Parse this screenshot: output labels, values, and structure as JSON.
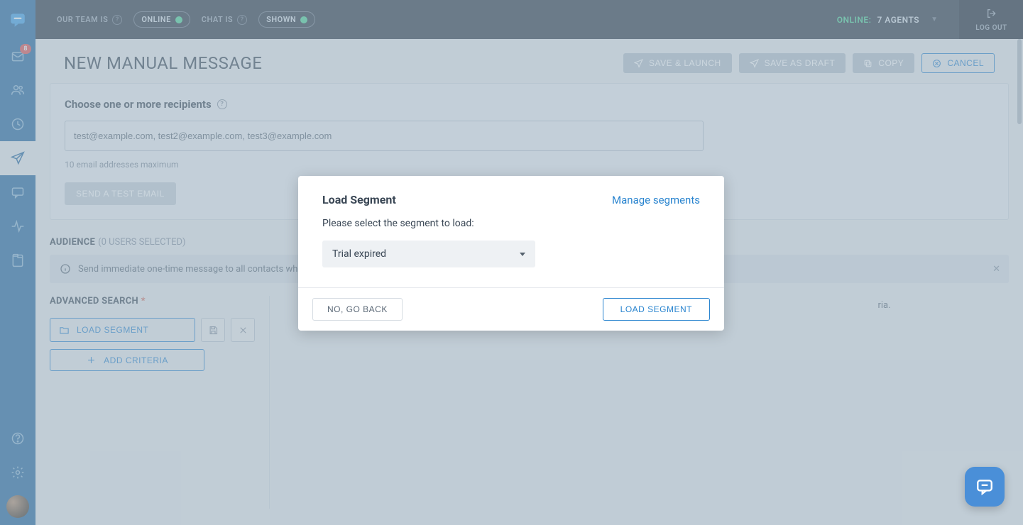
{
  "topbar": {
    "team_label": "OUR TEAM IS",
    "status_online": "ONLINE",
    "chat_label": "CHAT IS",
    "status_shown": "SHOWN",
    "online_label": "ONLINE:",
    "agents_count": "7 AGENTS",
    "logout": "LOG OUT"
  },
  "sidebar": {
    "inbox_badge": "8"
  },
  "page": {
    "title": "NEW MANUAL MESSAGE",
    "actions": {
      "save_launch": "SAVE & LAUNCH",
      "save_draft": "SAVE AS DRAFT",
      "copy": "COPY",
      "cancel": "CANCEL"
    }
  },
  "recipients": {
    "section_title": "Choose one or more recipients",
    "input_value": "test@example.com, test2@example.com, test3@example.com",
    "help": "10 email addresses maximum",
    "send_test": "SEND A TEST EMAIL"
  },
  "audience": {
    "label": "AUDIENCE",
    "sub": "(0 USERS SELECTED)",
    "info_text_partial": "Send immediate one-time message to all contacts who m",
    "preview_text_partial": "ria."
  },
  "advanced": {
    "title": "ADVANCED SEARCH",
    "load_segment": "LOAD SEGMENT",
    "add_criteria": "ADD CRITERIA"
  },
  "modal": {
    "title": "Load Segment",
    "manage": "Manage segments",
    "prompt": "Please select the segment to load:",
    "selected": "Trial expired",
    "back": "NO, GO BACK",
    "confirm": "LOAD SEGMENT"
  }
}
